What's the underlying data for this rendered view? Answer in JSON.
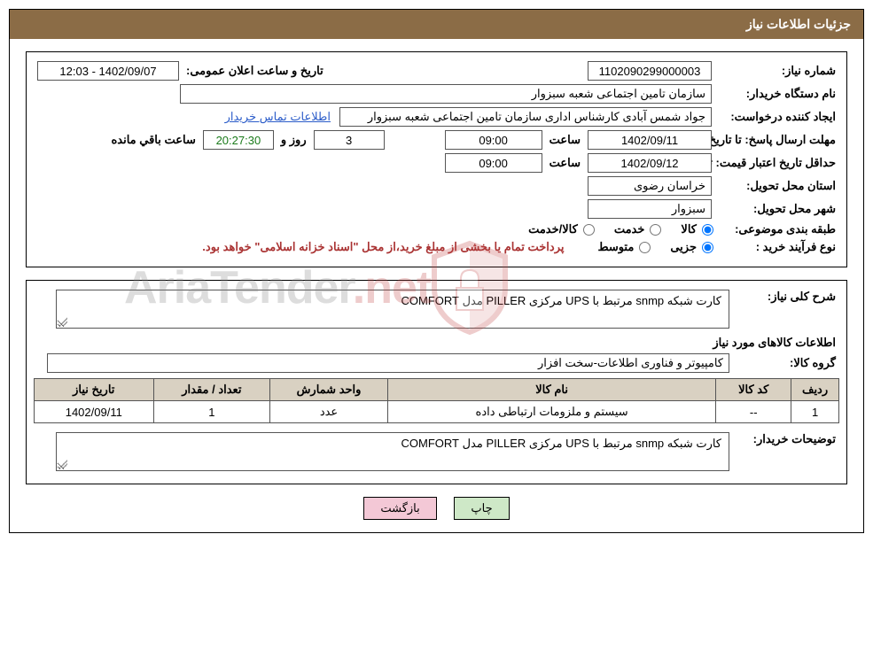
{
  "header": {
    "title": "جزئیات اطلاعات نیاز"
  },
  "fields": {
    "requirement_no_label": "شماره نیاز:",
    "requirement_no": "1102090299000003",
    "announce_dt_label": "تاریخ و ساعت اعلان عمومی:",
    "announce_dt": "1402/09/07 - 12:03",
    "buyer_org_label": "نام دستگاه خریدار:",
    "buyer_org": "سازمان تامین اجتماعی شعبه سبزوار",
    "requester_label": "ایجاد کننده درخواست:",
    "requester": "جواد شمس آبادی کارشناس اداری سازمان تامین اجتماعی شعبه سبزوار",
    "contact_link": "اطلاعات تماس خریدار",
    "reply_deadline_label": "مهلت ارسال پاسخ: تا تاریخ:",
    "reply_deadline_date": "1402/09/11",
    "time_label": "ساعت",
    "reply_deadline_time": "09:00",
    "days_remaining": "3",
    "days_and_label": "روز و",
    "countdown": "20:27:30",
    "remaining_label": "ساعت باقي مانده",
    "price_validity_label": "حداقل تاریخ اعتبار قیمت: تا تاریخ:",
    "price_validity_date": "1402/09/12",
    "price_validity_time": "09:00",
    "delivery_province_label": "استان محل تحویل:",
    "delivery_province": "خراسان رضوی",
    "delivery_city_label": "شهر محل تحویل:",
    "delivery_city": "سبزوار",
    "subject_class_label": "طبقه بندی موضوعی:",
    "subject_class_goods": "کالا",
    "subject_class_service": "خدمت",
    "subject_class_both": "کالا/خدمت",
    "purchase_type_label": "نوع فرآیند خرید :",
    "purchase_type_partial": "جزیی",
    "purchase_type_medium": "متوسط",
    "payment_note": "پرداخت تمام یا بخشی از مبلغ خرید،از محل \"اسناد خزانه اسلامی\" خواهد بود."
  },
  "desc": {
    "overall_label": "شرح کلی نیاز:",
    "overall_text": "کارت شبکه snmp مرتبط با UPS مرکزی PILLER مدل COMFORT",
    "goods_section_title": "اطلاعات کالاهای مورد نیاز",
    "goods_group_label": "گروه کالا:",
    "goods_group": "کامپیوتر و فناوری اطلاعات-سخت افزار",
    "buyer_notes_label": "توضیحات خریدار:",
    "buyer_notes": "کارت شبکه snmp مرتبط با UPS مرکزی PILLER مدل COMFORT"
  },
  "table": {
    "headers": {
      "row": "ردیف",
      "code": "کد کالا",
      "name": "نام کالا",
      "unit": "واحد شمارش",
      "qty": "تعداد / مقدار",
      "date": "تاریخ نیاز"
    },
    "rows": [
      {
        "row": "1",
        "code": "--",
        "name": "سیستم و ملزومات ارتباطی داده",
        "unit": "عدد",
        "qty": "1",
        "date": "1402/09/11"
      }
    ]
  },
  "buttons": {
    "print": "چاپ",
    "back": "بازگشت"
  },
  "watermark": {
    "text_main": "AriaTender",
    "text_suffix": ".net"
  }
}
